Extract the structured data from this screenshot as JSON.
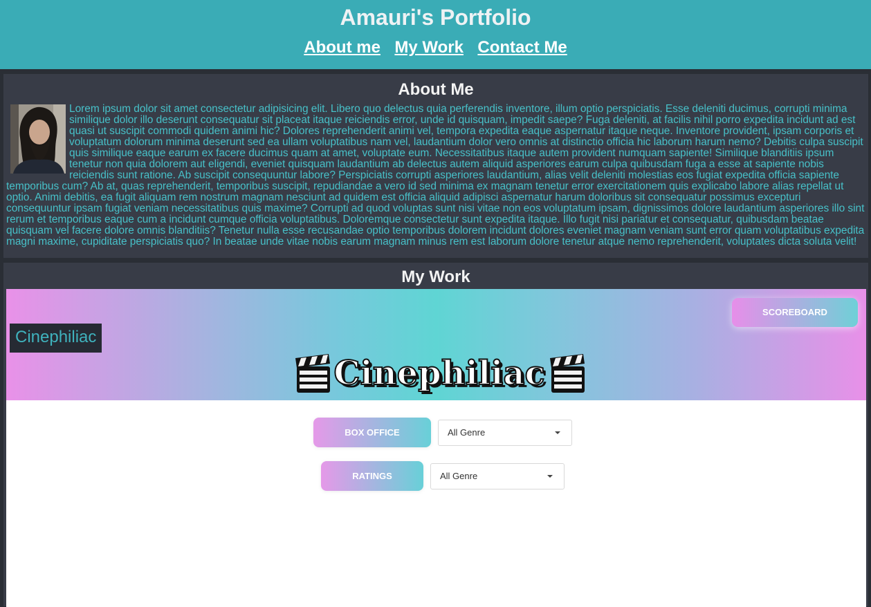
{
  "header": {
    "title": "Amauri's Portfolio",
    "nav": [
      "About me",
      "My Work",
      "Contact Me"
    ]
  },
  "about": {
    "title": "About Me",
    "avatar_alt": "profile-photo",
    "text": "Lorem ipsum dolor sit amet consectetur adipisicing elit. Libero quo delectus quia perferendis inventore, illum optio perspiciatis. Esse deleniti ducimus, corrupti minima similique dolor illo deserunt consequatur sit placeat itaque reiciendis error, unde id quisquam, impedit saepe? Fuga deleniti, at facilis nihil porro expedita incidunt ad est quasi ut suscipit commodi quidem animi hic? Dolores reprehenderit animi vel, tempora expedita eaque aspernatur itaque neque. Inventore provident, ipsam corporis et voluptatum dolorum minima deserunt sed ea ullam voluptatibus nam vel, laudantium dolor vero omnis at distinctio officia hic laborum harum nemo? Debitis culpa suscipit quis similique eaque earum ex facere ducimus quam at amet, voluptate eum. Necessitatibus itaque autem provident numquam sapiente! Similique blanditiis ipsum tenetur non quia dolorem aut eligendi, eveniet quisquam laudantium ab delectus autem aliquid asperiores earum culpa quibusdam fuga a esse at sapiente nobis reiciendis sunt ratione. Ab suscipit consequuntur labore? Perspiciatis corrupti asperiores laudantium, alias velit deleniti molestias eos fugiat expedita officia sapiente temporibus cum? Ab at, quas reprehenderit, temporibus suscipit, repudiandae a vero id sed minima ex magnam tenetur error exercitationem quis explicabo labore alias repellat ut optio. Animi debitis, ea fugit aliquam rem nostrum magnam nesciunt ad quidem est officia aliquid adipisci aspernatur harum doloribus sit consequatur possimus excepturi consequuntur ipsam fugiat veniam necessitatibus quis maxime? Corrupti ad quod voluptas sunt nisi vitae non eos voluptatum ipsam, dignissimos dolore laudantium asperiores illo sint rerum et temporibus eaque cum a incidunt cumque officia voluptatibus. Doloremque consectetur sunt expedita itaque. Illo fugit nisi pariatur et consequatur, quibusdam beatae quisquam vel facere dolore omnis blanditiis? Tenetur nulla esse recusandae optio temporibus dolorem incidunt dolores eveniet magnam veniam sunt error quam voluptatibus expedita magni maxime, cupiditate perspiciatis quo? In beatae unde vitae nobis earum magnam minus rem est laborum dolore tenetur atque nemo reprehenderit, voluptates dicta soluta velit!"
  },
  "work": {
    "title": "My Work",
    "project": {
      "brand": "Cinephiliac",
      "logo_text": "Cinephiliac",
      "scoreboard_label": "SCOREBOARD",
      "filters": [
        {
          "button": "BOX OFFICE",
          "select_value": "All Genre"
        },
        {
          "button": "RATINGS",
          "select_value": "All Genre"
        }
      ]
    }
  },
  "colors": {
    "header_bg": "#3aacb6",
    "panel_bg": "#383c47",
    "page_bg": "#2a2e35",
    "accent_text": "#47c0c8",
    "gradient_pink": "#e991e8",
    "gradient_teal": "#5fd5d4"
  }
}
